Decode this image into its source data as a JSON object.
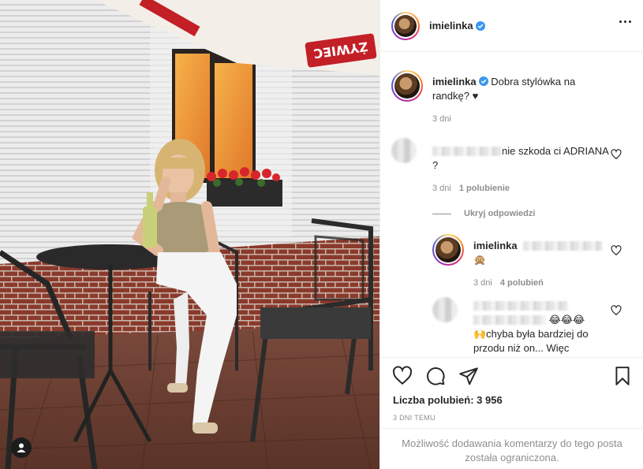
{
  "post": {
    "username": "imielinka",
    "verified": true
  },
  "caption": {
    "username": "imielinka",
    "text": "Dobra stylówka na randkę? ♥",
    "age": "3 dni"
  },
  "photo": {
    "umbrella_brand": "ŻYWIEC"
  },
  "comments": [
    {
      "username": "",
      "text": "nie szkoda ci ADRIANA ?",
      "age": "3 dni",
      "likes": "1 polubienie"
    }
  ],
  "hide_replies_label": "Ukryj odpowiedzi",
  "replies": [
    {
      "username": "imielinka",
      "text": "🙊",
      "age": "3 dni",
      "likes": "4 polubień"
    },
    {
      "username": "",
      "text_emoji": "😂😂😂",
      "text": "🙌chyba była bardziej do przodu niż on... Więc"
    }
  ],
  "footer": {
    "likes_text": "Liczba polubień: 3 956",
    "timestamp": "3 DNI TEMU",
    "restricted_notice": "Możliwość dodawania komentarzy do tego posta została ograniczona."
  },
  "colors": {
    "verified_blue": "#3897f0",
    "muted_text": "#8e8e8e",
    "border": "#efefef"
  },
  "icons": {
    "like": "heart-icon",
    "comment": "comment-icon",
    "share": "paper-plane-icon",
    "save": "bookmark-icon",
    "more": "more-dots-icon",
    "tag": "user-tag-icon"
  }
}
